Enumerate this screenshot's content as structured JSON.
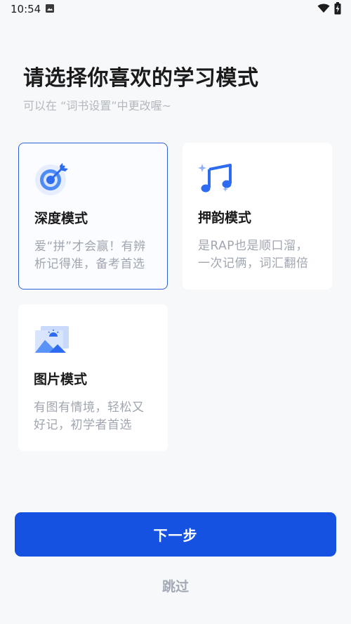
{
  "status_bar": {
    "time": "10:54"
  },
  "header": {
    "title": "请选择你喜欢的学习模式",
    "subtitle": "可以在 “词书设置”中更改喔~"
  },
  "modes": [
    {
      "icon": "target-icon",
      "title": "深度模式",
      "desc_lines": [
        "爱“拼”才会赢！有辨",
        "析记得准，备考首选"
      ],
      "selected": true
    },
    {
      "icon": "music-note-icon",
      "title": "押韵模式",
      "desc_lines": [
        "是RAP也是顺口溜，",
        "一次记俩，词汇翻倍"
      ],
      "selected": false
    },
    {
      "icon": "picture-icon",
      "title": "图片模式",
      "desc_lines": [
        "有图有情境，轻松又",
        "好记，初学者首选"
      ],
      "selected": false
    }
  ],
  "footer": {
    "next_label": "下一步",
    "skip_label": "跳过"
  },
  "colors": {
    "accent": "#1652e2",
    "selected_border": "#2f5fd8",
    "background": "#f7f8fa"
  }
}
